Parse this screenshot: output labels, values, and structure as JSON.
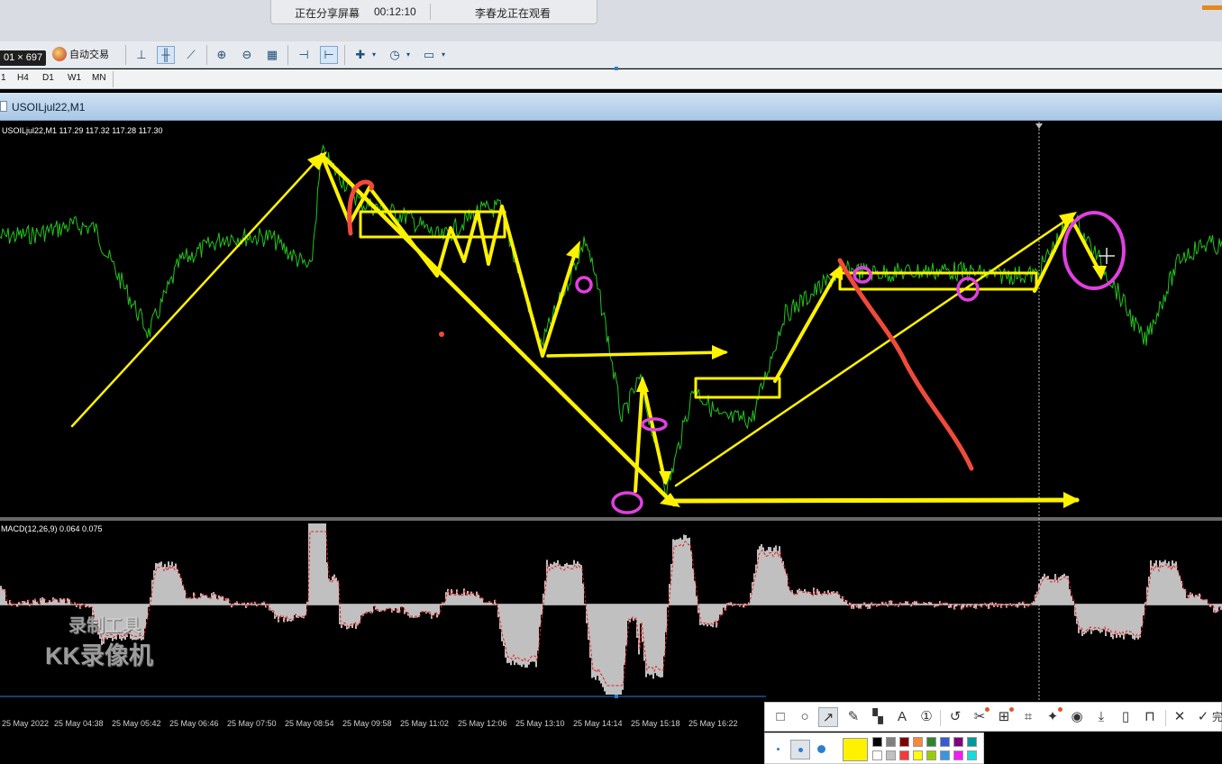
{
  "share_bar": {
    "status": "正在分享屏幕",
    "timer": "00:12:10",
    "viewer": "李春龙正在观看"
  },
  "toolbar": {
    "auto_trade_label": "自动交易",
    "size_tooltip": "01 × 697",
    "icons": [
      "new-order-icon",
      "auto-trade-icon",
      "bar-chart-icon",
      "candlestick-icon",
      "line-chart-icon",
      "zoom-in-icon",
      "zoom-out-icon",
      "tile-windows-icon",
      "chart-shift-icon",
      "autoscroll-icon",
      "indicators-icon",
      "periods-icon",
      "templates-icon"
    ]
  },
  "periods": {
    "items": [
      "1",
      "H4",
      "D1",
      "W1",
      "MN"
    ]
  },
  "chart": {
    "window_title": "USOILjul22,M1",
    "price_info": "USOILjul22,M1  117.29 117.32 117.28 117.30",
    "indicator_info": "MACD(12,26,9) 0.064 0.075",
    "time_labels": [
      "25 May 2022",
      "25 May 04:38",
      "25 May 05:42",
      "25 May 06:46",
      "25 May 07:50",
      "25 May 08:54",
      "25 May 09:58",
      "25 May 11:02",
      "25 May 12:06",
      "25 May 13:10",
      "25 May 14:14",
      "25 May 15:18",
      "25 May 16:22"
    ],
    "colors": {
      "background": "#000000",
      "price_line": "#22c51d",
      "macd_histogram": "#c0c0c0",
      "macd_signal": "#e02020",
      "annotation_yellow": "#fff200",
      "annotation_red": "#f04a3a",
      "annotation_magenta": "#e040e0"
    }
  },
  "watermark": {
    "line1": "录制工具",
    "line2": "KK录像机"
  },
  "annotation_toolbar": {
    "tools": [
      "rectangle-icon",
      "ellipse-icon",
      "arrow-icon",
      "pen-icon",
      "mosaic-icon",
      "text-icon",
      "number-icon",
      "undo-icon",
      "sticker-icon",
      "ocr-icon",
      "crop-icon",
      "pin-icon",
      "record-icon",
      "download-icon",
      "phone-icon",
      "bookmark-icon",
      "close-icon",
      "confirm-icon"
    ],
    "active_tool": "arrow-icon",
    "confirm_label": "完",
    "current_color": "#fff200",
    "palette": [
      "#000000",
      "#808080",
      "#800000",
      "#f7883a",
      "#308430",
      "#385ad3",
      "#800080",
      "#009999",
      "#ffffff",
      "#c0c0c0",
      "#fb3838",
      "#ffff00",
      "#99cc00",
      "#3894e4",
      "#f31bf3",
      "#16dcdc"
    ]
  }
}
